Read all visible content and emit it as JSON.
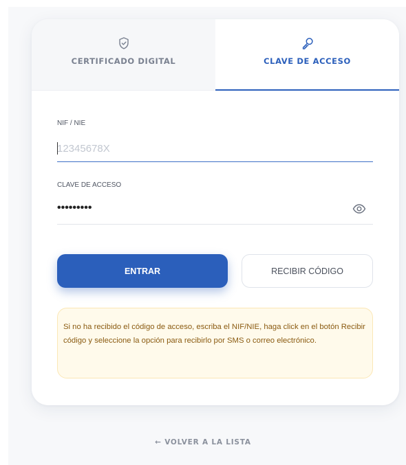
{
  "tabs": {
    "certificado": {
      "label": "CERTIFICADO DIGITAL",
      "icon": "shield-check-icon"
    },
    "clave": {
      "label": "CLAVE DE ACCESO",
      "icon": "key-icon",
      "active": true
    }
  },
  "form": {
    "nif_label": "NIF / NIE",
    "nif_placeholder": "12345678X",
    "nif_value": "",
    "password_label": "CLAVE DE ACCESO",
    "password_value": "•••••••••",
    "password_toggle_icon": "eye-icon"
  },
  "actions": {
    "primary_label": "ENTRAR",
    "secondary_label": "RECIBIR CÓDIGO"
  },
  "info": {
    "text": "Si no ha recibido el código de acceso, escriba el NIF/NIE, haga click en el botón Recibir código y seleccione la opción para recibirlo por SMS o correo electrónico."
  },
  "footer": {
    "back_label": "← VOLVER A LA LISTA"
  },
  "colors": {
    "accent": "#2b5fbb",
    "info_bg": "#fffaeb",
    "info_text": "#8a5a10"
  }
}
